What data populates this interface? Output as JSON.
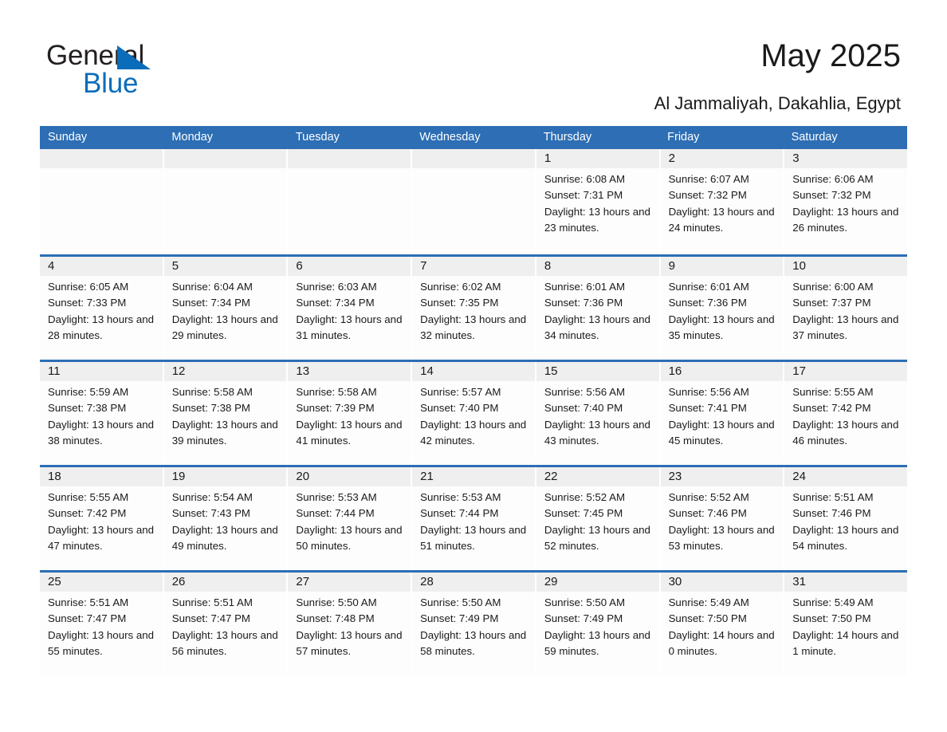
{
  "brand": {
    "word_one": "General",
    "word_two": "Blue",
    "triangle_icon": "triangle-icon",
    "accent_color": "#0b6dba"
  },
  "header": {
    "title": "May 2025",
    "subtitle": "Al Jammaliyah, Dakahlia, Egypt"
  },
  "theme": {
    "header_blue": "#2d6eb4",
    "daynum_gray": "#efefef",
    "cell_white": "#fdfdfd",
    "text": "#1a1a1a"
  },
  "calendar": {
    "weekdays": [
      "Sunday",
      "Monday",
      "Tuesday",
      "Wednesday",
      "Thursday",
      "Friday",
      "Saturday"
    ],
    "weeks": [
      [
        {
          "day": "",
          "empty": true
        },
        {
          "day": "",
          "empty": true
        },
        {
          "day": "",
          "empty": true
        },
        {
          "day": "",
          "empty": true
        },
        {
          "day": "1",
          "sunrise": "Sunrise: 6:08 AM",
          "sunset": "Sunset: 7:31 PM",
          "daylight": "Daylight: 13 hours and 23 minutes."
        },
        {
          "day": "2",
          "sunrise": "Sunrise: 6:07 AM",
          "sunset": "Sunset: 7:32 PM",
          "daylight": "Daylight: 13 hours and 24 minutes."
        },
        {
          "day": "3",
          "sunrise": "Sunrise: 6:06 AM",
          "sunset": "Sunset: 7:32 PM",
          "daylight": "Daylight: 13 hours and 26 minutes."
        }
      ],
      [
        {
          "day": "4",
          "sunrise": "Sunrise: 6:05 AM",
          "sunset": "Sunset: 7:33 PM",
          "daylight": "Daylight: 13 hours and 28 minutes."
        },
        {
          "day": "5",
          "sunrise": "Sunrise: 6:04 AM",
          "sunset": "Sunset: 7:34 PM",
          "daylight": "Daylight: 13 hours and 29 minutes."
        },
        {
          "day": "6",
          "sunrise": "Sunrise: 6:03 AM",
          "sunset": "Sunset: 7:34 PM",
          "daylight": "Daylight: 13 hours and 31 minutes."
        },
        {
          "day": "7",
          "sunrise": "Sunrise: 6:02 AM",
          "sunset": "Sunset: 7:35 PM",
          "daylight": "Daylight: 13 hours and 32 minutes."
        },
        {
          "day": "8",
          "sunrise": "Sunrise: 6:01 AM",
          "sunset": "Sunset: 7:36 PM",
          "daylight": "Daylight: 13 hours and 34 minutes."
        },
        {
          "day": "9",
          "sunrise": "Sunrise: 6:01 AM",
          "sunset": "Sunset: 7:36 PM",
          "daylight": "Daylight: 13 hours and 35 minutes."
        },
        {
          "day": "10",
          "sunrise": "Sunrise: 6:00 AM",
          "sunset": "Sunset: 7:37 PM",
          "daylight": "Daylight: 13 hours and 37 minutes."
        }
      ],
      [
        {
          "day": "11",
          "sunrise": "Sunrise: 5:59 AM",
          "sunset": "Sunset: 7:38 PM",
          "daylight": "Daylight: 13 hours and 38 minutes."
        },
        {
          "day": "12",
          "sunrise": "Sunrise: 5:58 AM",
          "sunset": "Sunset: 7:38 PM",
          "daylight": "Daylight: 13 hours and 39 minutes."
        },
        {
          "day": "13",
          "sunrise": "Sunrise: 5:58 AM",
          "sunset": "Sunset: 7:39 PM",
          "daylight": "Daylight: 13 hours and 41 minutes."
        },
        {
          "day": "14",
          "sunrise": "Sunrise: 5:57 AM",
          "sunset": "Sunset: 7:40 PM",
          "daylight": "Daylight: 13 hours and 42 minutes."
        },
        {
          "day": "15",
          "sunrise": "Sunrise: 5:56 AM",
          "sunset": "Sunset: 7:40 PM",
          "daylight": "Daylight: 13 hours and 43 minutes."
        },
        {
          "day": "16",
          "sunrise": "Sunrise: 5:56 AM",
          "sunset": "Sunset: 7:41 PM",
          "daylight": "Daylight: 13 hours and 45 minutes."
        },
        {
          "day": "17",
          "sunrise": "Sunrise: 5:55 AM",
          "sunset": "Sunset: 7:42 PM",
          "daylight": "Daylight: 13 hours and 46 minutes."
        }
      ],
      [
        {
          "day": "18",
          "sunrise": "Sunrise: 5:55 AM",
          "sunset": "Sunset: 7:42 PM",
          "daylight": "Daylight: 13 hours and 47 minutes."
        },
        {
          "day": "19",
          "sunrise": "Sunrise: 5:54 AM",
          "sunset": "Sunset: 7:43 PM",
          "daylight": "Daylight: 13 hours and 49 minutes."
        },
        {
          "day": "20",
          "sunrise": "Sunrise: 5:53 AM",
          "sunset": "Sunset: 7:44 PM",
          "daylight": "Daylight: 13 hours and 50 minutes."
        },
        {
          "day": "21",
          "sunrise": "Sunrise: 5:53 AM",
          "sunset": "Sunset: 7:44 PM",
          "daylight": "Daylight: 13 hours and 51 minutes."
        },
        {
          "day": "22",
          "sunrise": "Sunrise: 5:52 AM",
          "sunset": "Sunset: 7:45 PM",
          "daylight": "Daylight: 13 hours and 52 minutes."
        },
        {
          "day": "23",
          "sunrise": "Sunrise: 5:52 AM",
          "sunset": "Sunset: 7:46 PM",
          "daylight": "Daylight: 13 hours and 53 minutes."
        },
        {
          "day": "24",
          "sunrise": "Sunrise: 5:51 AM",
          "sunset": "Sunset: 7:46 PM",
          "daylight": "Daylight: 13 hours and 54 minutes."
        }
      ],
      [
        {
          "day": "25",
          "sunrise": "Sunrise: 5:51 AM",
          "sunset": "Sunset: 7:47 PM",
          "daylight": "Daylight: 13 hours and 55 minutes."
        },
        {
          "day": "26",
          "sunrise": "Sunrise: 5:51 AM",
          "sunset": "Sunset: 7:47 PM",
          "daylight": "Daylight: 13 hours and 56 minutes."
        },
        {
          "day": "27",
          "sunrise": "Sunrise: 5:50 AM",
          "sunset": "Sunset: 7:48 PM",
          "daylight": "Daylight: 13 hours and 57 minutes."
        },
        {
          "day": "28",
          "sunrise": "Sunrise: 5:50 AM",
          "sunset": "Sunset: 7:49 PM",
          "daylight": "Daylight: 13 hours and 58 minutes."
        },
        {
          "day": "29",
          "sunrise": "Sunrise: 5:50 AM",
          "sunset": "Sunset: 7:49 PM",
          "daylight": "Daylight: 13 hours and 59 minutes."
        },
        {
          "day": "30",
          "sunrise": "Sunrise: 5:49 AM",
          "sunset": "Sunset: 7:50 PM",
          "daylight": "Daylight: 14 hours and 0 minutes."
        },
        {
          "day": "31",
          "sunrise": "Sunrise: 5:49 AM",
          "sunset": "Sunset: 7:50 PM",
          "daylight": "Daylight: 14 hours and 1 minute."
        }
      ]
    ]
  }
}
